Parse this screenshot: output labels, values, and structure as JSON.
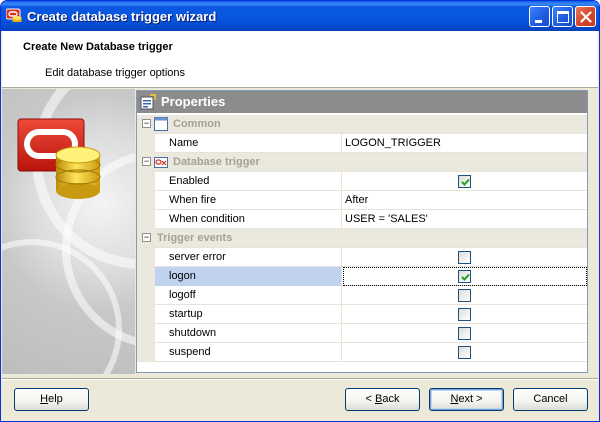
{
  "window": {
    "title": "Create database trigger wizard",
    "title_color": "#0a58e2"
  },
  "header": {
    "title": "Create New Database trigger",
    "subtitle": "Edit database trigger options"
  },
  "properties": {
    "title": "Properties",
    "categories": [
      {
        "label": "Common",
        "items": [
          {
            "name": "Name",
            "value": "LOGON_TRIGGER"
          }
        ]
      },
      {
        "label": "Database trigger",
        "items": [
          {
            "name": "Enabled",
            "checked": true
          },
          {
            "name": "When fire",
            "value": "After"
          },
          {
            "name": "When condition",
            "value": "USER = 'SALES'"
          }
        ]
      },
      {
        "label": "Trigger events",
        "items": [
          {
            "name": "server error",
            "checked": false
          },
          {
            "name": "logon",
            "checked": true,
            "selected": true
          },
          {
            "name": "logoff",
            "checked": false
          },
          {
            "name": "startup",
            "checked": false
          },
          {
            "name": "shutdown",
            "checked": false
          },
          {
            "name": "suspend",
            "checked": false
          }
        ]
      }
    ]
  },
  "buttons": {
    "help": {
      "pre": "",
      "key": "H",
      "post": "elp"
    },
    "back": {
      "pre": "< ",
      "key": "B",
      "post": "ack"
    },
    "next": {
      "pre": "",
      "key": "N",
      "post": "ext >"
    },
    "cancel": {
      "pre": "",
      "key": "",
      "post": "Cancel"
    }
  },
  "icons": {
    "app": "oracle-trigger-icon",
    "database": "database-cylinder-icon",
    "properties": "properties-icon"
  },
  "colors": {
    "check": "#21a121",
    "selected_row": "#c1d2ee",
    "category_bg": "#ebe9dd",
    "category_text": "#a5a293"
  }
}
